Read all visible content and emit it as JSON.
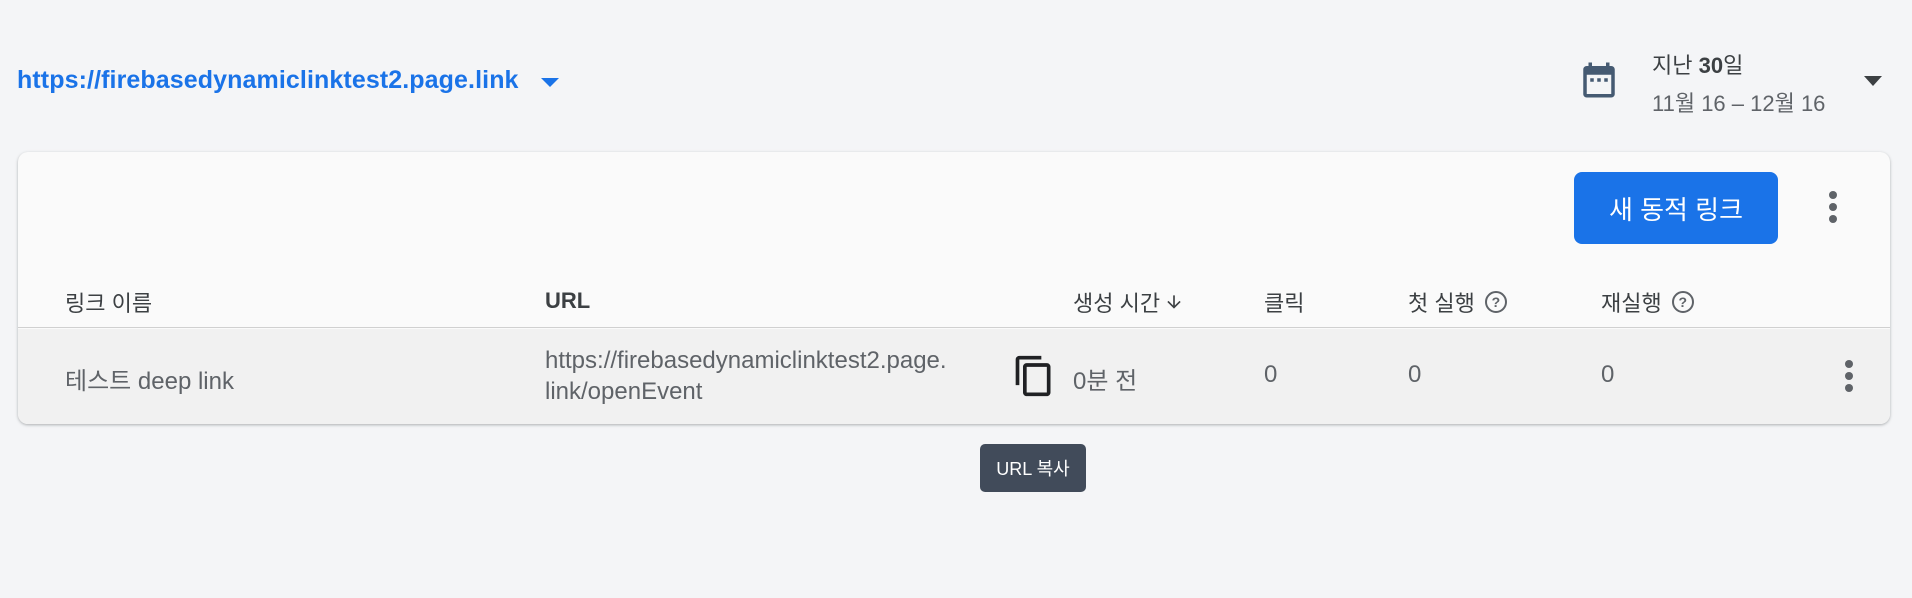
{
  "domain_selector": {
    "value": "https://firebasedynamiclinktest2.page.link"
  },
  "date_picker": {
    "title_prefix": "지난 ",
    "title_bold": "30",
    "title_suffix": "일",
    "range": "11월 16 – 12월 16"
  },
  "toolbar": {
    "new_link_label": "새 동적 링크"
  },
  "table": {
    "columns": [
      {
        "label": "링크 이름"
      },
      {
        "label": "URL"
      },
      {
        "label": "생성 시간"
      },
      {
        "label": "클릭"
      },
      {
        "label": "첫 실행"
      },
      {
        "label": "재실행"
      }
    ],
    "rows": [
      {
        "name": "테스트 deep link",
        "url_line1": "https://firebasedynamiclinktest2.page.",
        "url_line2": "link/openEvent",
        "created": "0분 전",
        "clicks": "0",
        "first_opens": "0",
        "reopens": "0"
      }
    ]
  },
  "tooltip": {
    "text": "URL 복사"
  },
  "colors": {
    "accent": "#1a73e8",
    "background": "#f4f5f7",
    "card": "#fafafa",
    "tooltip": "#414b5a"
  },
  "icons": [
    "chevron-down-icon",
    "calendar-icon",
    "more-vert-icon",
    "help-icon",
    "arrow-down-icon",
    "copy-icon"
  ]
}
